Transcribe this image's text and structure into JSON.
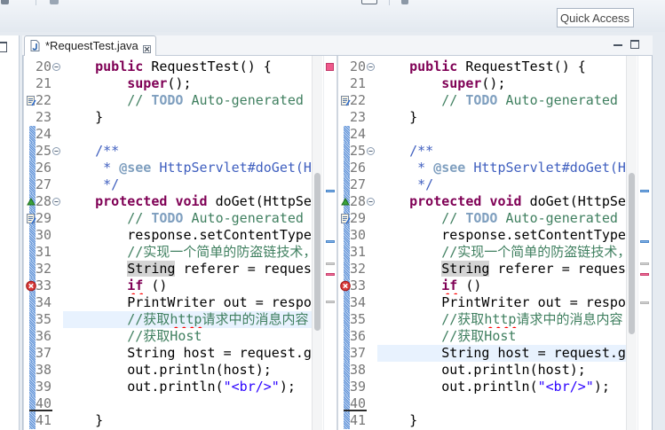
{
  "toolbar": {
    "quick_access_placeholder": "Quick Access",
    "icons": [
      "toolbar-icon",
      "toolbar-icon",
      "perspective-icon",
      "toolbar-icon"
    ]
  },
  "editor": {
    "tab": {
      "title": "*RequestTest.java",
      "icon": "java-file-icon",
      "close_icon": "close-icon"
    },
    "window_controls": [
      "minimize-icon",
      "maximize-icon"
    ],
    "colors": {
      "current_line": "#E8F2FE",
      "line_number": "#787878",
      "quick_diff": "#5B8FD6"
    },
    "panes": [
      {
        "current_line": 35
      },
      {
        "current_line": 37
      }
    ],
    "lines": [
      {
        "number": "20",
        "fold": "collapse-icon",
        "tokens": [
          {
            "text": "    "
          },
          {
            "text": "public",
            "color": "#7F0055",
            "bold": true
          },
          {
            "text": " RequestTest() {"
          }
        ]
      },
      {
        "number": "21",
        "tokens": [
          {
            "text": "        "
          },
          {
            "text": "super",
            "color": "#7F0055",
            "bold": true
          },
          {
            "text": "();"
          }
        ]
      },
      {
        "number": "22",
        "annotation": "task-icon",
        "tokens": [
          {
            "text": "        "
          },
          {
            "text": "// ",
            "color": "#3F7F5F"
          },
          {
            "text": "TODO",
            "color": "#7F9FBF",
            "bold": true
          },
          {
            "text": " Auto-generated",
            "color": "#3F7F5F"
          }
        ]
      },
      {
        "number": "23",
        "tokens": [
          {
            "text": "    }"
          }
        ]
      },
      {
        "number": "24",
        "changed": true,
        "tokens": []
      },
      {
        "number": "25",
        "fold": "collapse-icon",
        "changed": true,
        "tokens": [
          {
            "text": "    "
          },
          {
            "text": "/**",
            "color": "#3F5FBF"
          }
        ]
      },
      {
        "number": "26",
        "changed": true,
        "tokens": [
          {
            "text": "     "
          },
          {
            "text": "* ",
            "color": "#3F5FBF"
          },
          {
            "text": "@see",
            "color": "#7F9FBF",
            "bold": true
          },
          {
            "text": " HttpServlet#doGet(H",
            "color": "#3F5FBF"
          }
        ]
      },
      {
        "number": "27",
        "changed": true,
        "tokens": [
          {
            "text": "     "
          },
          {
            "text": "*/",
            "color": "#3F5FBF"
          }
        ]
      },
      {
        "number": "28",
        "fold": "collapse-icon",
        "annotation": "override-triangle-icon",
        "changed": true,
        "tokens": [
          {
            "text": "    "
          },
          {
            "text": "protected",
            "color": "#7F0055",
            "bold": true
          },
          {
            "text": " "
          },
          {
            "text": "void",
            "color": "#7F0055",
            "bold": true
          },
          {
            "text": " doGet(HttpSe"
          }
        ]
      },
      {
        "number": "29",
        "annotation": "task-icon",
        "changed": true,
        "tokens": [
          {
            "text": "        "
          },
          {
            "text": "// ",
            "color": "#3F7F5F"
          },
          {
            "text": "TODO",
            "color": "#7F9FBF",
            "bold": true
          },
          {
            "text": " Auto-generated",
            "color": "#3F7F5F"
          }
        ]
      },
      {
        "number": "30",
        "changed": true,
        "tokens": [
          {
            "text": "        response.setContentType"
          }
        ]
      },
      {
        "number": "31",
        "changed": true,
        "tokens": [
          {
            "text": "        "
          },
          {
            "text": "//实现一个简单的防盗链技术，不是准",
            "color": "#3F7F5F"
          }
        ]
      },
      {
        "number": "32",
        "changed": true,
        "tokens": [
          {
            "text": "        "
          },
          {
            "text": "String",
            "bg": "#D4D4D4"
          },
          {
            "text": " referer = reques"
          }
        ]
      },
      {
        "number": "33",
        "annotation": "error-icon",
        "changed": true,
        "tokens": [
          {
            "text": "        "
          },
          {
            "text": "if",
            "color": "#7F0055",
            "bold": true,
            "squiggle": "#FF0000"
          },
          {
            "text": " ()"
          }
        ]
      },
      {
        "number": "34",
        "changed": true,
        "tokens": [
          {
            "text": "        PrintWriter out = respo"
          }
        ]
      },
      {
        "number": "35",
        "changed": true,
        "tokens": [
          {
            "text": "        "
          },
          {
            "text": "//获取",
            "color": "#3F7F5F"
          },
          {
            "text": "http",
            "color": "#3F7F5F",
            "squiggle": "#FF0000"
          },
          {
            "text": "请求中的消息内容",
            "color": "#3F7F5F"
          }
        ]
      },
      {
        "number": "36",
        "changed": true,
        "tokens": [
          {
            "text": "        "
          },
          {
            "text": "//获取Host",
            "color": "#3F7F5F"
          }
        ]
      },
      {
        "number": "37",
        "changed": true,
        "tokens": [
          {
            "text": "        String host = request.g"
          }
        ]
      },
      {
        "number": "38",
        "changed": true,
        "tokens": [
          {
            "text": "        out.println(host);"
          }
        ]
      },
      {
        "number": "39",
        "changed": true,
        "tokens": [
          {
            "text": "        out.println("
          },
          {
            "text": "\"<br/>\"",
            "color": "#2A00FF"
          },
          {
            "text": ");"
          }
        ]
      },
      {
        "number": "40",
        "changed": true,
        "deleted_below": true,
        "tokens": []
      },
      {
        "number": "41",
        "changed": true,
        "tokens": [
          {
            "text": "    }"
          }
        ]
      }
    ]
  }
}
